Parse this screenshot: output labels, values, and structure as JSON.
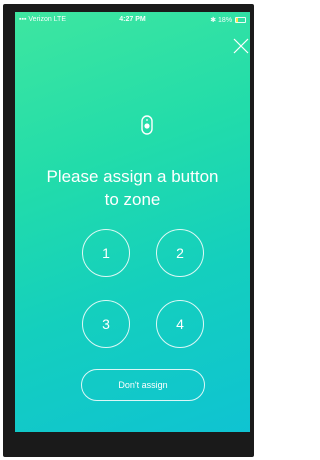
{
  "status_bar": {
    "carrier": "Verizon  LTE",
    "time": "4:27 PM",
    "battery": "18%"
  },
  "icons": {
    "close": "close-icon",
    "zone": "button-device-icon"
  },
  "title_line1": "Please assign a button",
  "title_line2": "to zone",
  "zone_buttons": [
    "1",
    "2",
    "3",
    "4"
  ],
  "dont_assign_label": "Don't assign",
  "colors": {
    "gradient_top": "#3ee6a0",
    "gradient_bottom": "#0fc3d2",
    "foreground": "#ffffff"
  }
}
